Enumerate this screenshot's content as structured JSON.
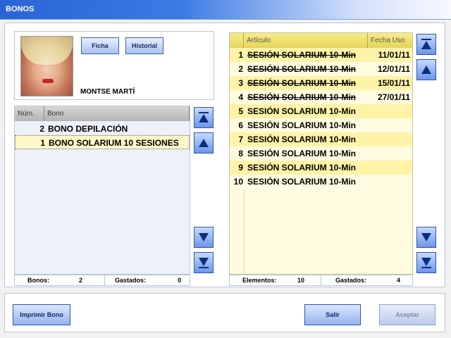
{
  "window": {
    "title": "BONOS"
  },
  "client": {
    "name": "MONTSE MARTÍ",
    "buttons": {
      "ficha": "Ficha",
      "historial": "Historial"
    }
  },
  "bonos_table": {
    "columns": [
      "Núm.",
      "Bono"
    ],
    "rows": [
      {
        "num": "2",
        "name": "BONO DEPILACIÓN",
        "selected": false
      },
      {
        "num": "1",
        "name": "BONO SOLARIUM 10 SESIONES",
        "selected": true
      }
    ],
    "footer": {
      "bonos_label": "Bonos:",
      "bonos_value": "2",
      "gastados_label": "Gastados:",
      "gastados_value": "0"
    }
  },
  "articulos_table": {
    "columns": [
      "Artículo",
      "Fecha Uso"
    ],
    "rows": [
      {
        "num": "1",
        "name": "SESIÓN SOLARIUM 10-Min",
        "date": "11/01/11",
        "used": true
      },
      {
        "num": "2",
        "name": "SESIÓN SOLARIUM 10-Min",
        "date": "12/01/11",
        "used": true
      },
      {
        "num": "3",
        "name": "SESIÓN SOLARIUM 10-Min",
        "date": "15/01/11",
        "used": true
      },
      {
        "num": "4",
        "name": "SESIÓN SOLARIUM 10-Min",
        "date": "27/01/11",
        "used": true
      },
      {
        "num": "5",
        "name": "SESIÓN SOLARIUM 10-Min",
        "date": "",
        "used": false
      },
      {
        "num": "6",
        "name": "SESIÓN SOLARIUM 10-Min",
        "date": "",
        "used": false
      },
      {
        "num": "7",
        "name": "SESIÓN SOLARIUM 10-Min",
        "date": "",
        "used": false
      },
      {
        "num": "8",
        "name": "SESIÓN SOLARIUM 10-Min",
        "date": "",
        "used": false
      },
      {
        "num": "9",
        "name": "SESIÓN SOLARIUM 10-Min",
        "date": "",
        "used": false
      },
      {
        "num": "10",
        "name": "SESIÓN SOLARIUM 10-Min",
        "date": "",
        "used": false
      }
    ],
    "footer": {
      "elementos_label": "Elementos:",
      "elementos_value": "10",
      "gastados_label": "Gastados:",
      "gastados_value": "4"
    }
  },
  "buttons": {
    "imprimir": "Imprimir Bono",
    "salir": "Salir",
    "aceptar": "Aceptar"
  },
  "colors": {
    "accent": "#2a63d6",
    "row_alt": "#fff3a8",
    "row_plain": "#fffbe0"
  }
}
